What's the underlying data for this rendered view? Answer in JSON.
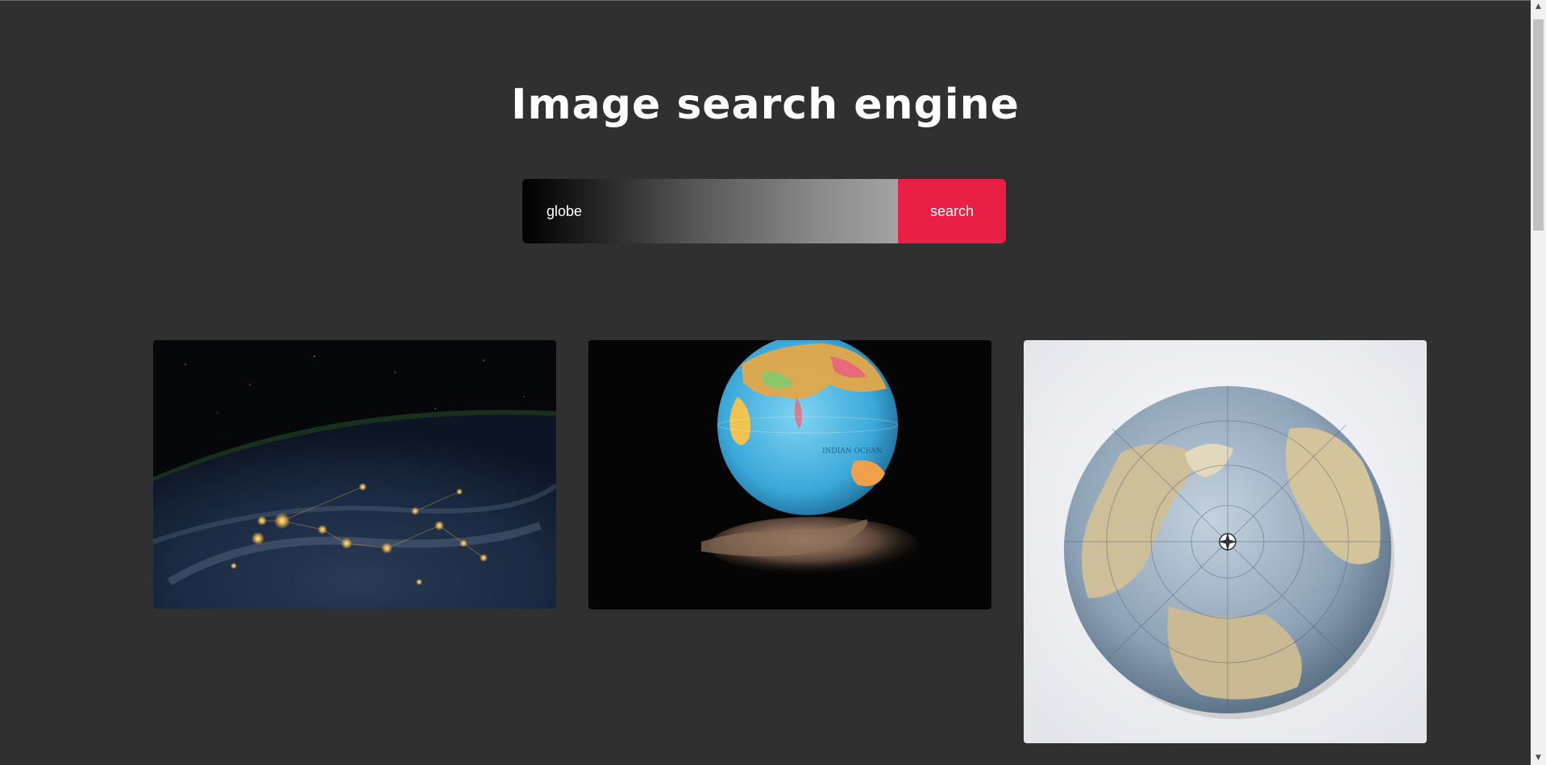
{
  "page": {
    "title": "Image search engine"
  },
  "search": {
    "value": "globe",
    "button_label": "search"
  },
  "results": [
    {
      "name": "earth-night-from-space"
    },
    {
      "name": "glowing-globe-over-hand"
    },
    {
      "name": "antique-globe-north-pole"
    }
  ],
  "colors": {
    "background": "#303030",
    "accent": "#ea1f45"
  },
  "scrollbar": {
    "up_icon": "chevron-up-icon",
    "down_icon": "chevron-down-icon"
  }
}
